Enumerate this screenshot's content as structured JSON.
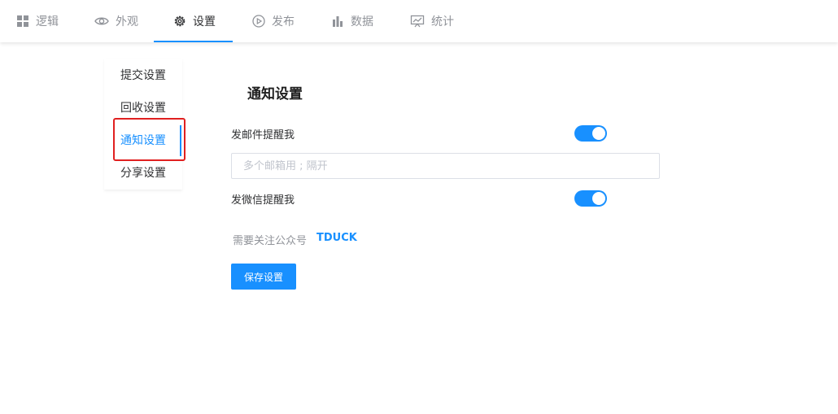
{
  "nav": {
    "tabs": [
      {
        "label": "逻辑",
        "icon": "grid-icon"
      },
      {
        "label": "外观",
        "icon": "eye-icon"
      },
      {
        "label": "设置",
        "icon": "gear-icon"
      },
      {
        "label": "发布",
        "icon": "play-icon"
      },
      {
        "label": "数据",
        "icon": "bar-chart-icon"
      },
      {
        "label": "统计",
        "icon": "presentation-chart-icon"
      }
    ],
    "active_index": 2
  },
  "sidebar": {
    "items": [
      {
        "label": "提交设置"
      },
      {
        "label": "回收设置"
      },
      {
        "label": "通知设置"
      },
      {
        "label": "分享设置"
      }
    ],
    "active_index": 2
  },
  "main": {
    "title": "通知设置",
    "email_notify": {
      "label": "发邮件提醒我",
      "enabled": true
    },
    "email_input": {
      "value": "",
      "placeholder": "多个邮箱用 ; 隔开"
    },
    "wechat_notify": {
      "label": "发微信提醒我",
      "enabled": true
    },
    "note": "需要关注公众号",
    "brand": "TDUCK",
    "save_label": "保存设置"
  },
  "colors": {
    "accent": "#1890ff",
    "highlight_box": "#e02020",
    "muted_text": "#909399"
  }
}
